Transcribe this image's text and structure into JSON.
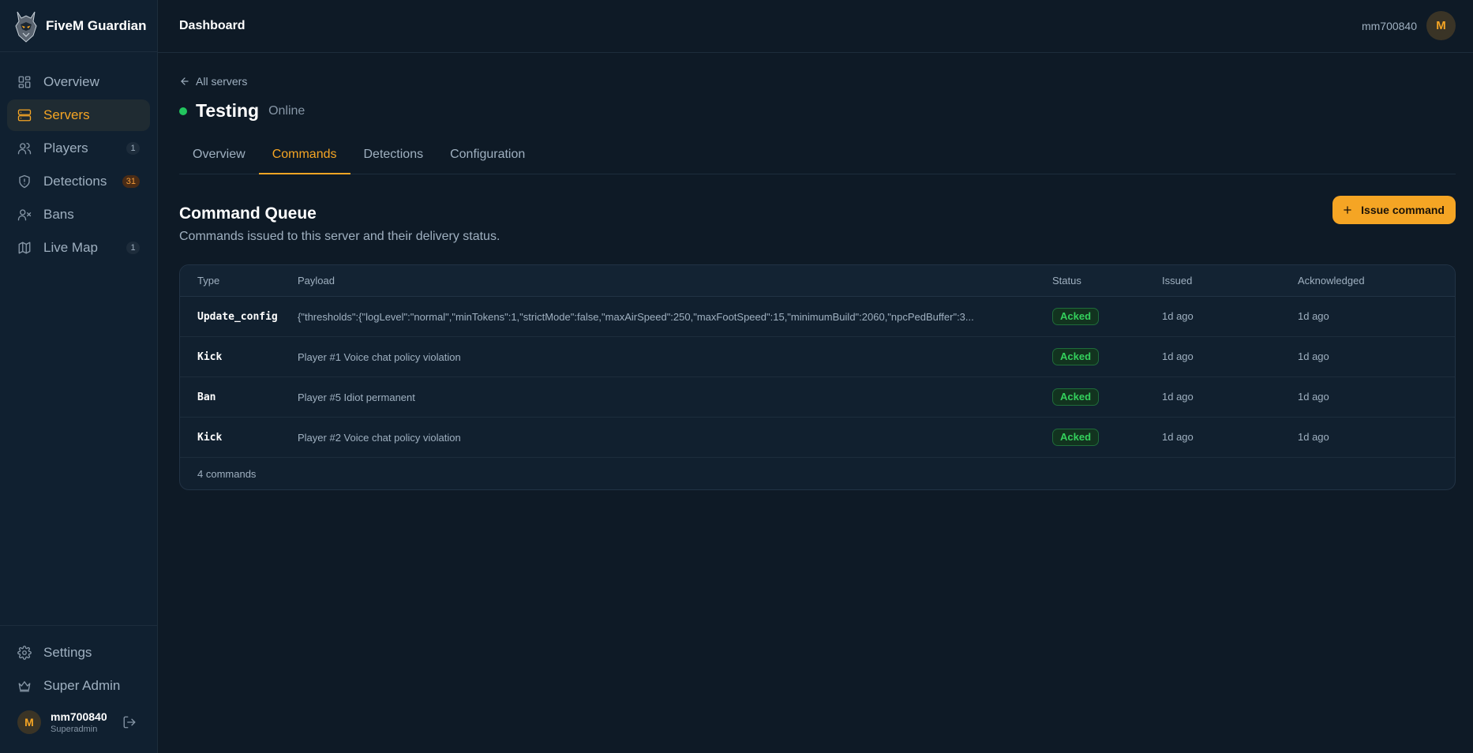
{
  "brand": {
    "name": "FiveM Guardian"
  },
  "sidebar": {
    "items": [
      {
        "label": "Overview",
        "icon": "grid-icon",
        "badge": ""
      },
      {
        "label": "Servers",
        "icon": "server-icon",
        "badge": "",
        "active": true
      },
      {
        "label": "Players",
        "icon": "users-icon",
        "badge": "1"
      },
      {
        "label": "Detections",
        "icon": "shield-icon",
        "badge": "31"
      },
      {
        "label": "Bans",
        "icon": "user-x-icon",
        "badge": ""
      },
      {
        "label": "Live Map",
        "icon": "map-icon",
        "badge": "1"
      }
    ],
    "bottom_items": [
      {
        "label": "Settings",
        "icon": "gear-icon"
      },
      {
        "label": "Super Admin",
        "icon": "crown-icon"
      }
    ],
    "user": {
      "avatar": "M",
      "name": "mm700840",
      "role": "Superadmin"
    }
  },
  "header": {
    "title": "Dashboard",
    "username": "mm700840",
    "avatar": "M"
  },
  "server": {
    "back_label": "All servers",
    "name": "Testing",
    "status": "Online",
    "status_color": "#22c55e"
  },
  "tabs": [
    {
      "label": "Overview"
    },
    {
      "label": "Commands",
      "active": true
    },
    {
      "label": "Detections"
    },
    {
      "label": "Configuration"
    }
  ],
  "queue": {
    "title": "Command Queue",
    "subtitle": "Commands issued to this server and their delivery status.",
    "issue_button": "Issue command",
    "columns": [
      "Type",
      "Payload",
      "Status",
      "Issued",
      "Acknowledged"
    ],
    "rows": [
      {
        "type": "Update_config",
        "payload": "{\"thresholds\":{\"logLevel\":\"normal\",\"minTokens\":1,\"strictMode\":false,\"maxAirSpeed\":250,\"maxFootSpeed\":15,\"minimumBuild\":2060,\"npcPedBuffer\":3...",
        "status": "Acked",
        "issued": "1d ago",
        "acknowledged": "1d ago"
      },
      {
        "type": "Kick",
        "payload": "Player #1 Voice chat policy violation",
        "status": "Acked",
        "issued": "1d ago",
        "acknowledged": "1d ago"
      },
      {
        "type": "Ban",
        "payload": "Player #5 Idiot permanent",
        "status": "Acked",
        "issued": "1d ago",
        "acknowledged": "1d ago"
      },
      {
        "type": "Kick",
        "payload": "Player #2 Voice chat policy violation",
        "status": "Acked",
        "issued": "1d ago",
        "acknowledged": "1d ago"
      }
    ],
    "footer": "4 commands"
  },
  "colors": {
    "accent": "#f5a524",
    "background": "#0e1a26",
    "sidebar": "#102030",
    "success": "#34d05c"
  }
}
